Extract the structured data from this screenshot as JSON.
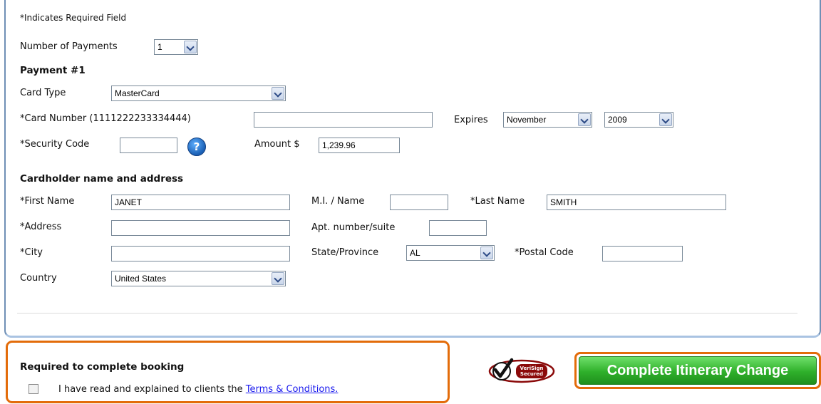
{
  "required_note": "*Indicates Required Field",
  "num_payments": {
    "label": "Number of Payments",
    "value": "1"
  },
  "payment_heading": "Payment #1",
  "card_type": {
    "label": "Card Type",
    "value": "MasterCard"
  },
  "card_number": {
    "label": "*Card Number (1111222233334444)",
    "value": ""
  },
  "expires": {
    "label": "Expires",
    "month": "November",
    "year": "2009"
  },
  "security_code": {
    "label": "*Security Code",
    "value": ""
  },
  "amount": {
    "label": "Amount $",
    "value": "1,239.96"
  },
  "cardholder_heading": "Cardholder name and address",
  "first_name": {
    "label": "*First Name",
    "value": "JANET"
  },
  "mi": {
    "label": "M.I. / Name",
    "value": ""
  },
  "last_name": {
    "label": "*Last Name",
    "value": "SMITH"
  },
  "address": {
    "label": "*Address",
    "value": ""
  },
  "apt": {
    "label": "Apt. number/suite",
    "value": ""
  },
  "city": {
    "label": "*City",
    "value": ""
  },
  "state": {
    "label": "State/Province",
    "value": "AL"
  },
  "postal": {
    "label": "*Postal Code",
    "value": ""
  },
  "country": {
    "label": "Country",
    "value": "United States"
  },
  "booking": {
    "heading": "Required to complete booking",
    "terms_prefix": "I have read and explained to clients the",
    "terms_link": "Terms & Conditions.",
    "checked": false
  },
  "verisign": {
    "line1": "VeriSign",
    "line2": "Secured"
  },
  "complete_button": "Complete Itinerary Change",
  "colors": {
    "accent_orange": "#e36c0a",
    "button_green": "#2fb02b",
    "link_blue": "#1a1aee",
    "panel_border": "#6f8fb5"
  },
  "icons": {
    "help": "help-question-icon",
    "verisign": "verisign-check-icon",
    "dropdown": "chevron-down-icon"
  }
}
